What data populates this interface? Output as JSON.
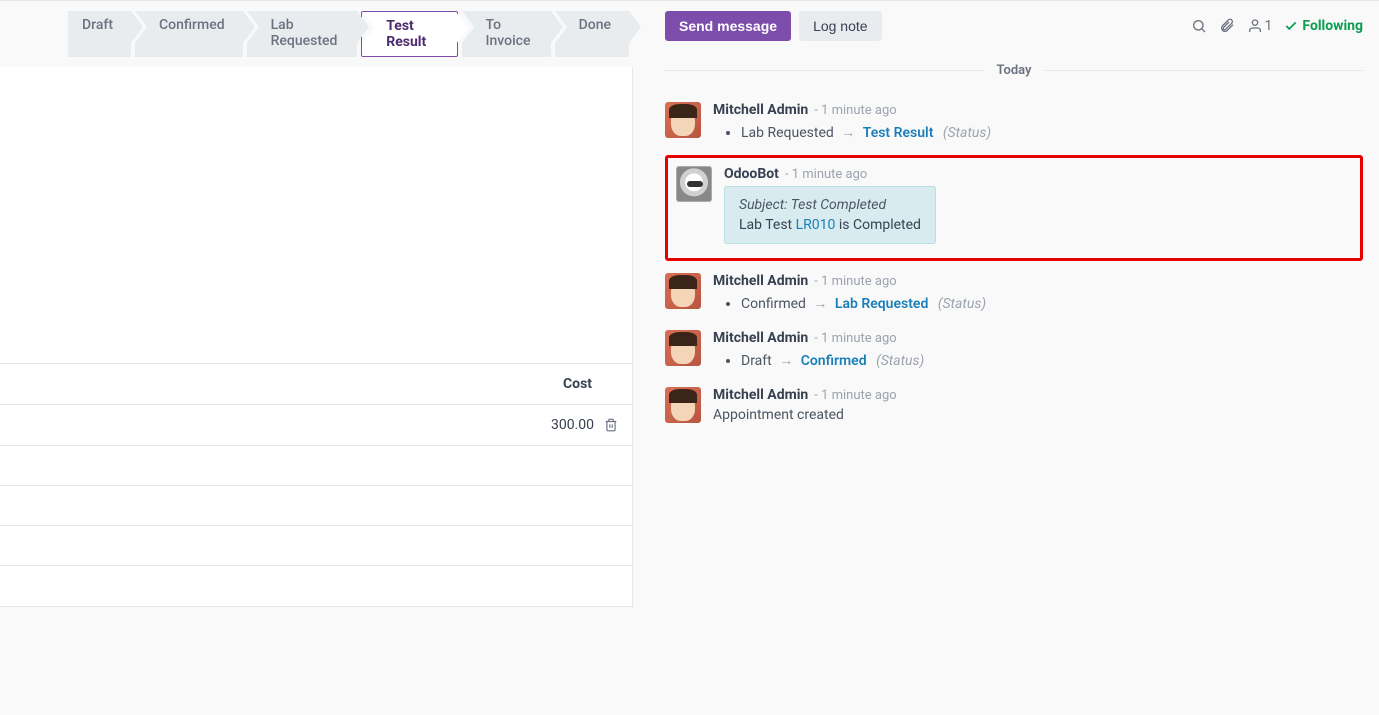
{
  "status_steps": [
    "Draft",
    "Confirmed",
    "Lab Requested",
    "Test Result",
    "To Invoice",
    "Done"
  ],
  "active_step_index": 3,
  "cost": {
    "header": "Cost",
    "value": "300.00"
  },
  "chatter": {
    "send_message": "Send message",
    "log_note": "Log note",
    "follower_count": "1",
    "following": "Following",
    "today": "Today"
  },
  "messages": [
    {
      "author": "Mitchell Admin",
      "time": "- 1 minute ago",
      "type": "status",
      "from": "Lab Requested",
      "to": "Test Result",
      "field": "(Status)"
    },
    {
      "author": "OdooBot",
      "time": "- 1 minute ago",
      "type": "bot",
      "subject_prefix": "Subject: ",
      "subject": "Test Completed",
      "body_prefix": "Lab Test ",
      "body_link": "LR010",
      "body_suffix": " is Completed"
    },
    {
      "author": "Mitchell Admin",
      "time": "- 1 minute ago",
      "type": "status",
      "from": "Confirmed",
      "to": "Lab Requested",
      "field": "(Status)"
    },
    {
      "author": "Mitchell Admin",
      "time": "- 1 minute ago",
      "type": "status",
      "from": "Draft",
      "to": "Confirmed",
      "field": "(Status)"
    },
    {
      "author": "Mitchell Admin",
      "time": "- 1 minute ago",
      "type": "text",
      "text": "Appointment created"
    }
  ]
}
